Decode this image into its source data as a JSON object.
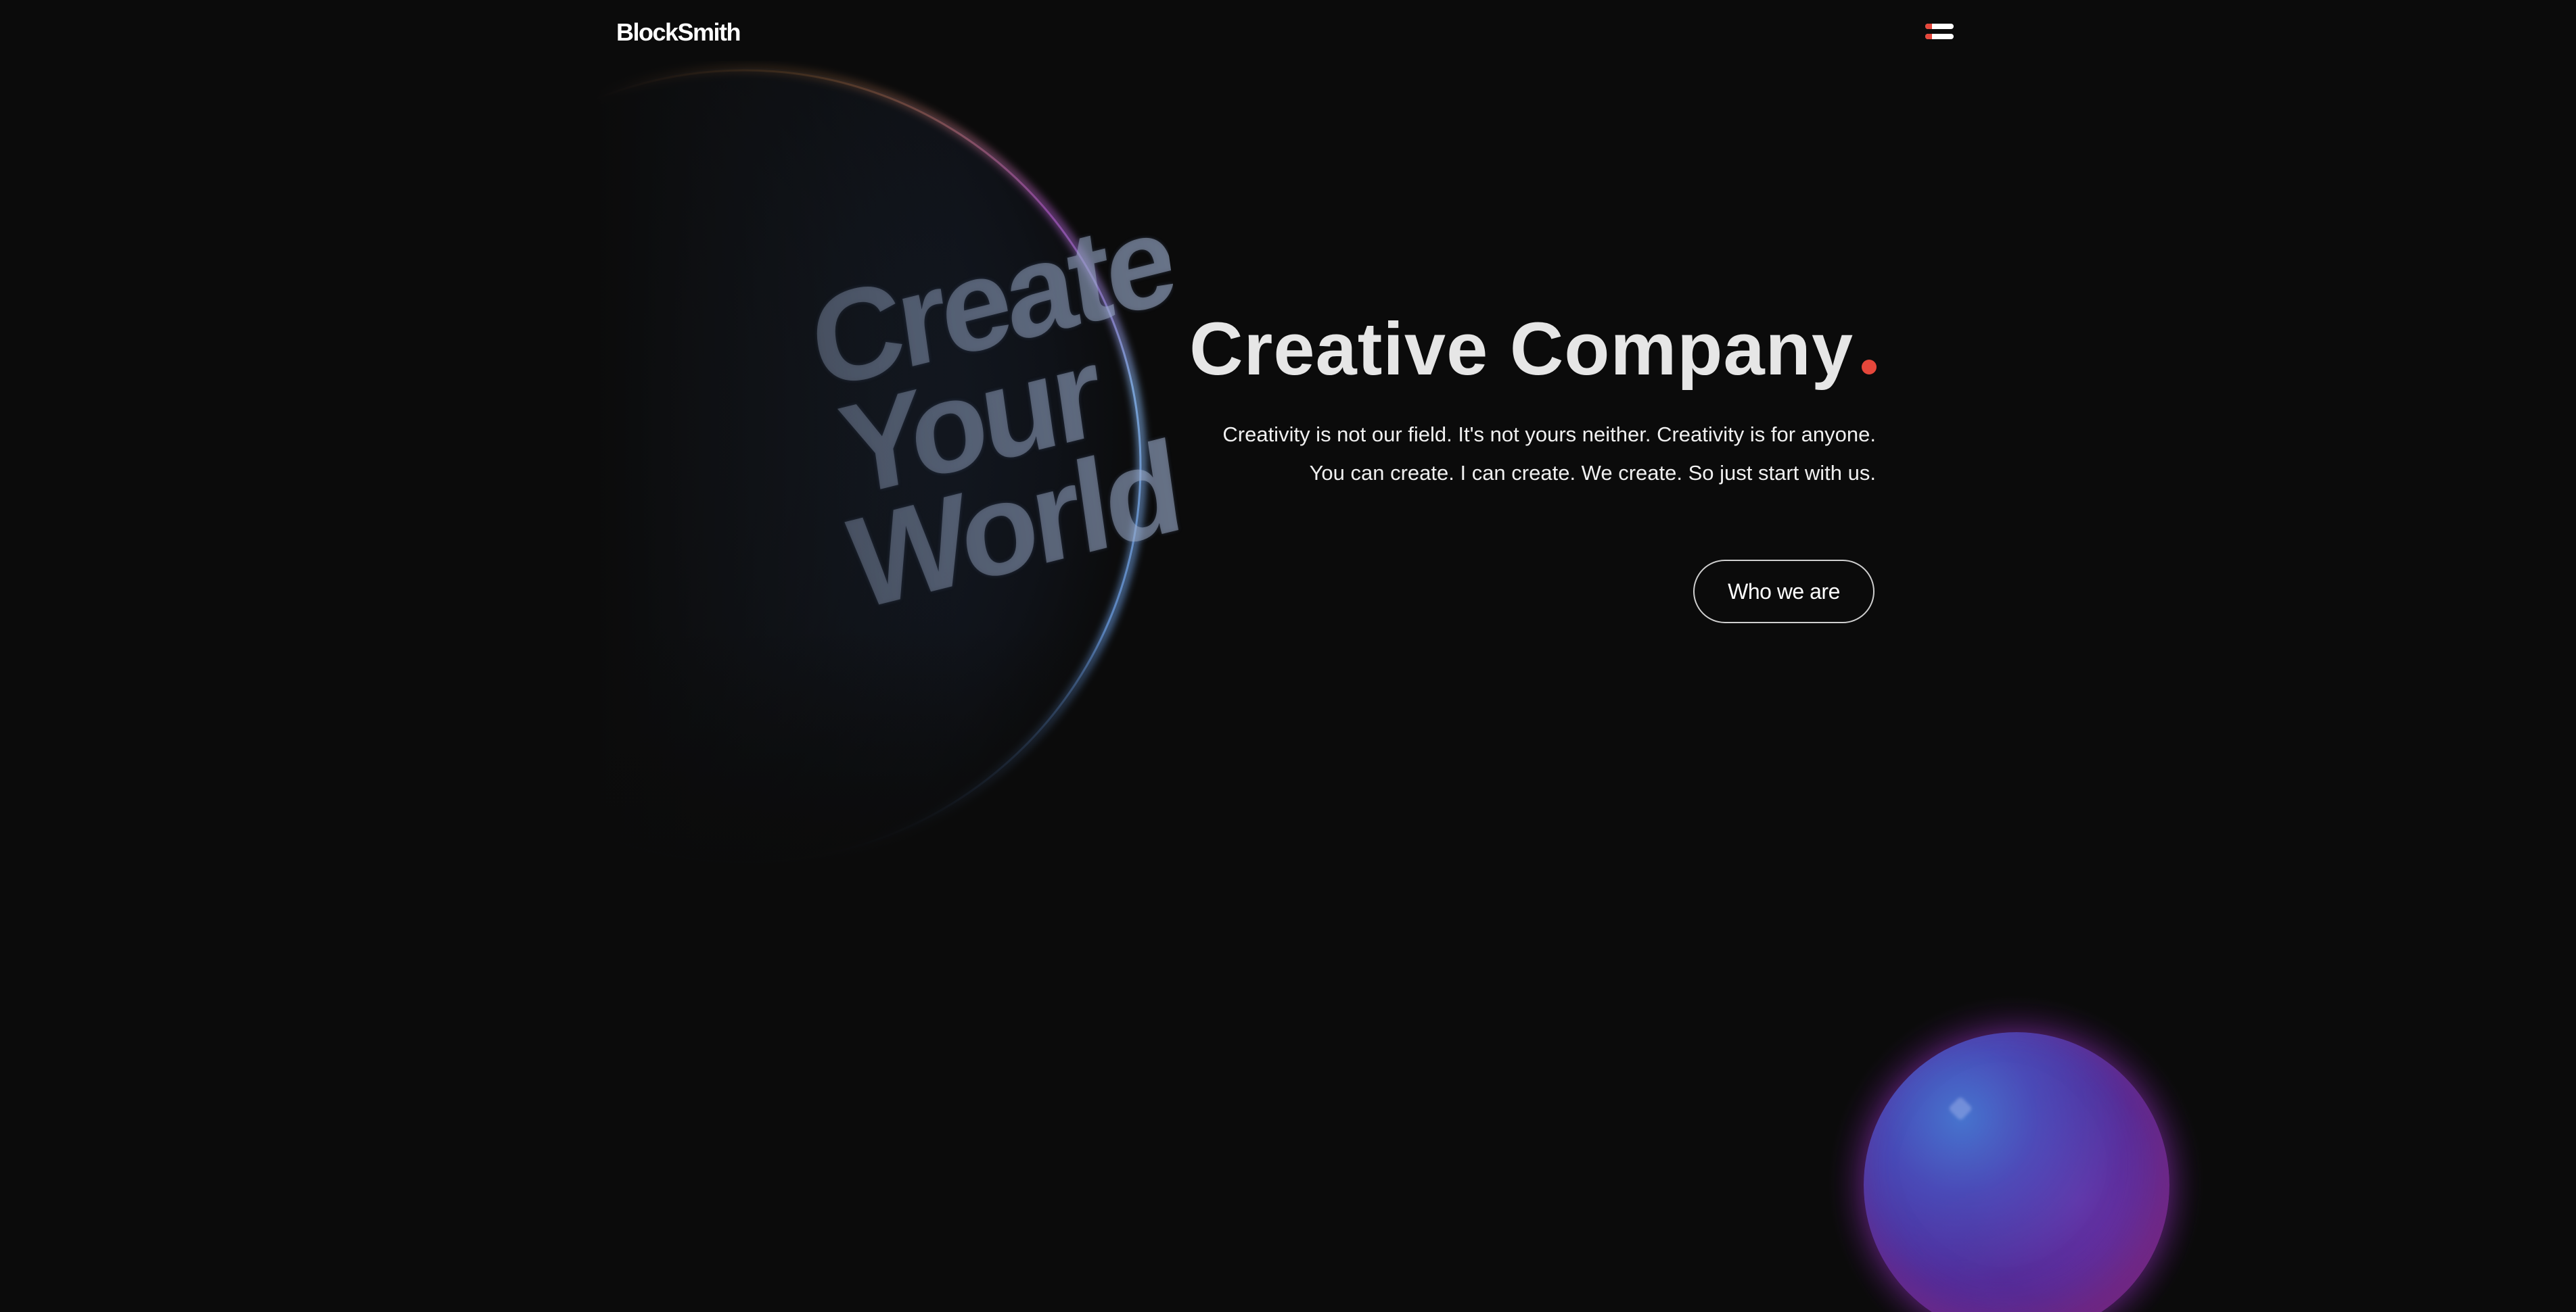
{
  "header": {
    "logo_text": "BlockSmith",
    "menu_icon": "hamburger-menu-icon"
  },
  "hero": {
    "title": "Creative Company",
    "title_dot_color": "#e5473b",
    "subtitle_lines": [
      "Creativity is not our field. It's not yours neither. Creativity is for anyone.",
      "You can create. I can create. We create. So just start with us."
    ],
    "cta_label": "Who we are"
  },
  "planet": {
    "text_lines": [
      "Create",
      "Your",
      "World"
    ]
  },
  "colors": {
    "background": "#0b0b0b",
    "accent": "#e5473b",
    "text": "#e6e6e6"
  }
}
